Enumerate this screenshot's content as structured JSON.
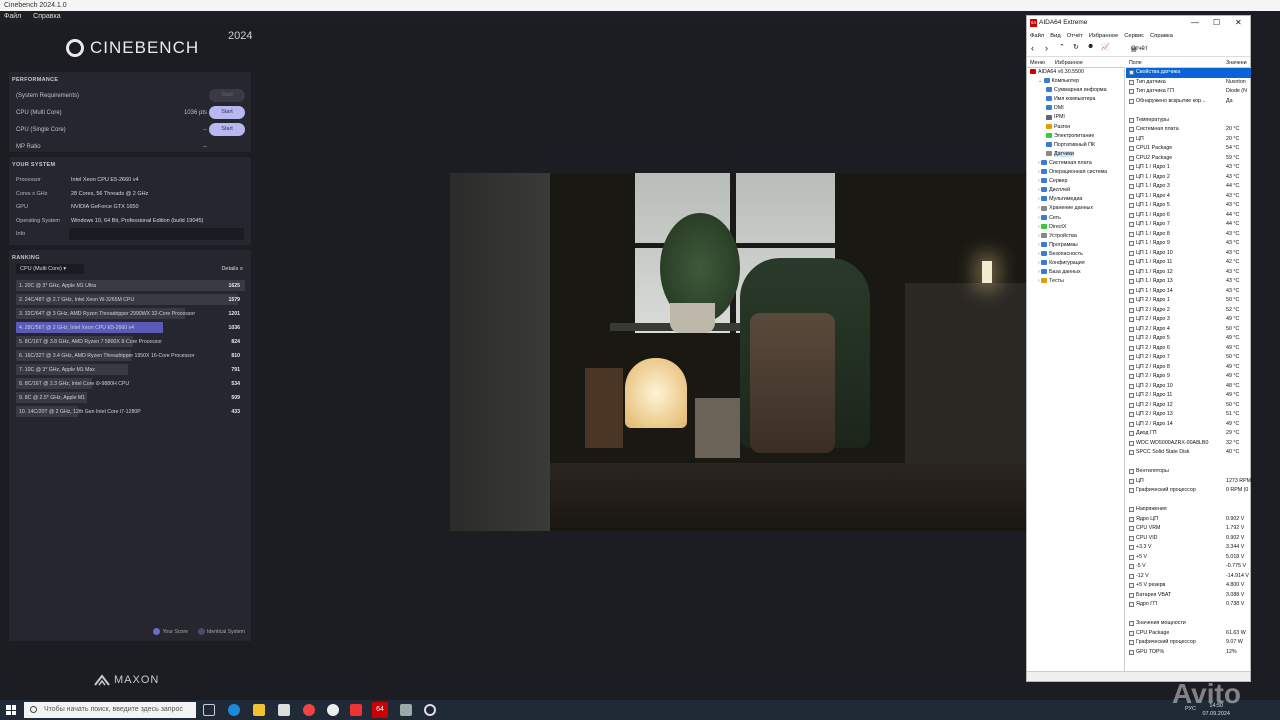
{
  "cinebench": {
    "title_bar": "Cinebench 2024.1.0",
    "menu": [
      "Файл",
      "Справка"
    ],
    "logo": "CINEBENCH",
    "year": "2024",
    "performance": {
      "header": "PERFORMANCE",
      "rows": [
        {
          "label": "(System Requirements)",
          "pts": "",
          "button": "Start",
          "enabled": false
        },
        {
          "label": "CPU (Multi Core)",
          "pts": "1036 pts",
          "button": "Start",
          "enabled": true
        },
        {
          "label": "CPU (Single Core)",
          "pts": "--",
          "button": "Start",
          "enabled": true
        },
        {
          "label": "MP Ratio",
          "pts": "--",
          "button": "",
          "enabled": false
        }
      ]
    },
    "system": {
      "header": "YOUR SYSTEM",
      "rows": [
        {
          "k": "Processor",
          "v": "Intel Xeon CPU E5-2660 v4"
        },
        {
          "k": "Cores x GHz",
          "v": "28 Cores, 56 Threads @ 2 GHz"
        },
        {
          "k": "GPU",
          "v": "NVIDIA GeForce GTX 1650"
        },
        {
          "k": "Operating System",
          "v": "Windows 10, 64 Bit, Professional Edition (build 19045)"
        },
        {
          "k": "Info",
          "v": ""
        }
      ]
    },
    "ranking": {
      "header": "RANKING",
      "selector": "CPU (Multi Core)",
      "details": "Details",
      "items": [
        {
          "text": "1. 20C @ 3* GHz, Apple M1 Ultra",
          "score": "1625",
          "you": false,
          "frac": 1.0
        },
        {
          "text": "2. 24C/48T @ 2.7 GHz, Intel Xeon W-3265M CPU",
          "score": "1579",
          "you": false,
          "frac": 0.97
        },
        {
          "text": "3. 32C/64T @ 3 GHz, AMD Ryzen Threadripper 2990WX 32-Core Processor",
          "score": "1201",
          "you": false,
          "frac": 0.74
        },
        {
          "text": "4. 28C/56T @ 2 GHz, Intel Xeon CPU E5-2660 v4",
          "score": "1036",
          "you": true,
          "frac": 0.64
        },
        {
          "text": "5. 8C/16T @ 3.8 GHz, AMD Ryzen 7 5800X 8-Core Processor",
          "score": "824",
          "you": false,
          "frac": 0.51
        },
        {
          "text": "6. 16C/32T @ 3.4 GHz, AMD Ryzen Threadripper 1950X 16-Core Processor",
          "score": "810",
          "you": false,
          "frac": 0.5
        },
        {
          "text": "7. 10C @ 3* GHz, Apple M1 Max",
          "score": "791",
          "you": false,
          "frac": 0.49
        },
        {
          "text": "8. 8C/16T @ 2.3 GHz, Intel Core i9-9880H CPU",
          "score": "534",
          "you": false,
          "frac": 0.33
        },
        {
          "text": "9. 8C @ 2.5* GHz, Apple M1",
          "score": "509",
          "you": false,
          "frac": 0.31
        },
        {
          "text": "10. 14C/20T @ 2 GHz, 12th Gen Intel Core i7-1280P",
          "score": "433",
          "you": false,
          "frac": 0.27
        }
      ],
      "legend": [
        "Your Score",
        "Identical System"
      ]
    },
    "footer": "MAXON"
  },
  "aida": {
    "title": "AIDA64 Extreme",
    "menu": [
      "Файл",
      "Вид",
      "Отчёт",
      "Избранное",
      "Сервис",
      "Справка"
    ],
    "report": "Отчёт",
    "tabs": [
      "Меню",
      "Избранное"
    ],
    "col_field": "Поле",
    "col_value": "Значени",
    "tree": [
      {
        "t": "AIDA64 v6.30.5500",
        "lvl": 0,
        "c": "#c00"
      },
      {
        "t": "Компьютер",
        "lvl": 1,
        "c": "#3a7bd5"
      },
      {
        "t": "Суммарная информа",
        "lvl": 2,
        "c": "#3a7bd5"
      },
      {
        "t": "Имя компьютера",
        "lvl": 2,
        "c": "#3a7bd5"
      },
      {
        "t": "DMI",
        "lvl": 2,
        "c": "#3a7bd5"
      },
      {
        "t": "IPMI",
        "lvl": 2,
        "c": "#666"
      },
      {
        "t": "Разгон",
        "lvl": 2,
        "c": "#e69b00"
      },
      {
        "t": "Электропитание",
        "lvl": 2,
        "c": "#3c3"
      },
      {
        "t": "Портативный ПК",
        "lvl": 2,
        "c": "#3a7bd5"
      },
      {
        "t": "Датчики",
        "lvl": 2,
        "c": "#888",
        "sel": true
      },
      {
        "t": "Системная плата",
        "lvl": 1,
        "c": "#3a7bd5"
      },
      {
        "t": "Операционная система",
        "lvl": 1,
        "c": "#3a7bd5"
      },
      {
        "t": "Сервер",
        "lvl": 1,
        "c": "#3a7bd5"
      },
      {
        "t": "Дисплей",
        "lvl": 1,
        "c": "#3a7bd5"
      },
      {
        "t": "Мультимедиа",
        "lvl": 1,
        "c": "#3a7bd5"
      },
      {
        "t": "Хранение данных",
        "lvl": 1,
        "c": "#888"
      },
      {
        "t": "Сеть",
        "lvl": 1,
        "c": "#3a7bd5"
      },
      {
        "t": "DirectX",
        "lvl": 1,
        "c": "#3c3"
      },
      {
        "t": "Устройства",
        "lvl": 1,
        "c": "#888"
      },
      {
        "t": "Программы",
        "lvl": 1,
        "c": "#3a7bd5"
      },
      {
        "t": "Безопасность",
        "lvl": 1,
        "c": "#3a7bd5"
      },
      {
        "t": "Конфигурация",
        "lvl": 1,
        "c": "#3a7bd5"
      },
      {
        "t": "База данных",
        "lvl": 1,
        "c": "#3a7bd5"
      },
      {
        "t": "Тесты",
        "lvl": 1,
        "c": "#e69b00"
      }
    ],
    "rows": [
      {
        "f": "Свойства датчика",
        "v": "",
        "g": true,
        "hl": true
      },
      {
        "f": "Тип датчика",
        "v": "Nuvoton"
      },
      {
        "f": "Тип датчика ГП",
        "v": "Diode (N"
      },
      {
        "f": "Обнаружено вскрытие кор...",
        "v": "Да"
      },
      {
        "f": "",
        "v": ""
      },
      {
        "f": "Температуры",
        "v": "",
        "g": true
      },
      {
        "f": "Системная плата",
        "v": "20 °C"
      },
      {
        "f": "ЦП",
        "v": "20 °C"
      },
      {
        "f": "CPU1 Package",
        "v": "54 °C"
      },
      {
        "f": "CPU2 Package",
        "v": "59 °C"
      },
      {
        "f": "ЦП 1 / Ядро 1",
        "v": "43 °C"
      },
      {
        "f": "ЦП 1 / Ядро 2",
        "v": "43 °C"
      },
      {
        "f": "ЦП 1 / Ядро 3",
        "v": "44 °C"
      },
      {
        "f": "ЦП 1 / Ядро 4",
        "v": "43 °C"
      },
      {
        "f": "ЦП 1 / Ядро 5",
        "v": "43 °C"
      },
      {
        "f": "ЦП 1 / Ядро 6",
        "v": "44 °C"
      },
      {
        "f": "ЦП 1 / Ядро 7",
        "v": "44 °C"
      },
      {
        "f": "ЦП 1 / Ядро 8",
        "v": "43 °C"
      },
      {
        "f": "ЦП 1 / Ядро 9",
        "v": "43 °C"
      },
      {
        "f": "ЦП 1 / Ядро 10",
        "v": "43 °C"
      },
      {
        "f": "ЦП 1 / Ядро 11",
        "v": "42 °C"
      },
      {
        "f": "ЦП 1 / Ядро 12",
        "v": "43 °C"
      },
      {
        "f": "ЦП 1 / Ядро 13",
        "v": "43 °C"
      },
      {
        "f": "ЦП 1 / Ядро 14",
        "v": "43 °C"
      },
      {
        "f": "ЦП 2 / Ядро 1",
        "v": "50 °C"
      },
      {
        "f": "ЦП 2 / Ядро 2",
        "v": "52 °C"
      },
      {
        "f": "ЦП 2 / Ядро 3",
        "v": "49 °C"
      },
      {
        "f": "ЦП 2 / Ядро 4",
        "v": "50 °C"
      },
      {
        "f": "ЦП 2 / Ядро 5",
        "v": "49 °C"
      },
      {
        "f": "ЦП 2 / Ядро 6",
        "v": "49 °C"
      },
      {
        "f": "ЦП 2 / Ядро 7",
        "v": "50 °C"
      },
      {
        "f": "ЦП 2 / Ядро 8",
        "v": "49 °C"
      },
      {
        "f": "ЦП 2 / Ядро 9",
        "v": "49 °C"
      },
      {
        "f": "ЦП 2 / Ядро 10",
        "v": "48 °C"
      },
      {
        "f": "ЦП 2 / Ядро 11",
        "v": "49 °C"
      },
      {
        "f": "ЦП 2 / Ядро 12",
        "v": "50 °C"
      },
      {
        "f": "ЦП 2 / Ядро 13",
        "v": "51 °C"
      },
      {
        "f": "ЦП 2 / Ядро 14",
        "v": "49 °C"
      },
      {
        "f": "Диод ГП",
        "v": "29 °C"
      },
      {
        "f": "WDC WD5000AZRX-00A8LB0",
        "v": "32 °C"
      },
      {
        "f": "SPCC Solid State Disk",
        "v": "40 °C"
      },
      {
        "f": "",
        "v": ""
      },
      {
        "f": "Вентиляторы",
        "v": "",
        "g": true
      },
      {
        "f": "ЦП",
        "v": "1273 RPM"
      },
      {
        "f": "Графический процессор",
        "v": "0 RPM (0"
      },
      {
        "f": "",
        "v": ""
      },
      {
        "f": "Напряжения",
        "v": "",
        "g": true
      },
      {
        "f": "Ядро ЦП",
        "v": "0.902 V"
      },
      {
        "f": "CPU VRM",
        "v": "1.792 V"
      },
      {
        "f": "CPU VID",
        "v": "0.902 V"
      },
      {
        "f": "+3.3 V",
        "v": "3.344 V"
      },
      {
        "f": "+5 V",
        "v": "5.018 V"
      },
      {
        "f": "-5 V",
        "v": "-0.775 V"
      },
      {
        "f": "-12 V",
        "v": "-14.914 V"
      },
      {
        "f": "+5 V резерв",
        "v": "4.800 V"
      },
      {
        "f": "Батарея VBAT",
        "v": "3.088 V"
      },
      {
        "f": "Ядро ГП",
        "v": "0.738 V"
      },
      {
        "f": "",
        "v": ""
      },
      {
        "f": "Значения мощности",
        "v": "",
        "g": true
      },
      {
        "f": "CPU Package",
        "v": "61.63 W"
      },
      {
        "f": "Графический процессор",
        "v": "9.07 W"
      },
      {
        "f": "GPU TDP%",
        "v": "12%"
      }
    ]
  },
  "taskbar": {
    "search_placeholder": "Чтобы начать поиск, введите здесь запрос",
    "lang": "РУС",
    "time": "14:50",
    "date": "07.09.2024"
  },
  "watermark": "Avito"
}
